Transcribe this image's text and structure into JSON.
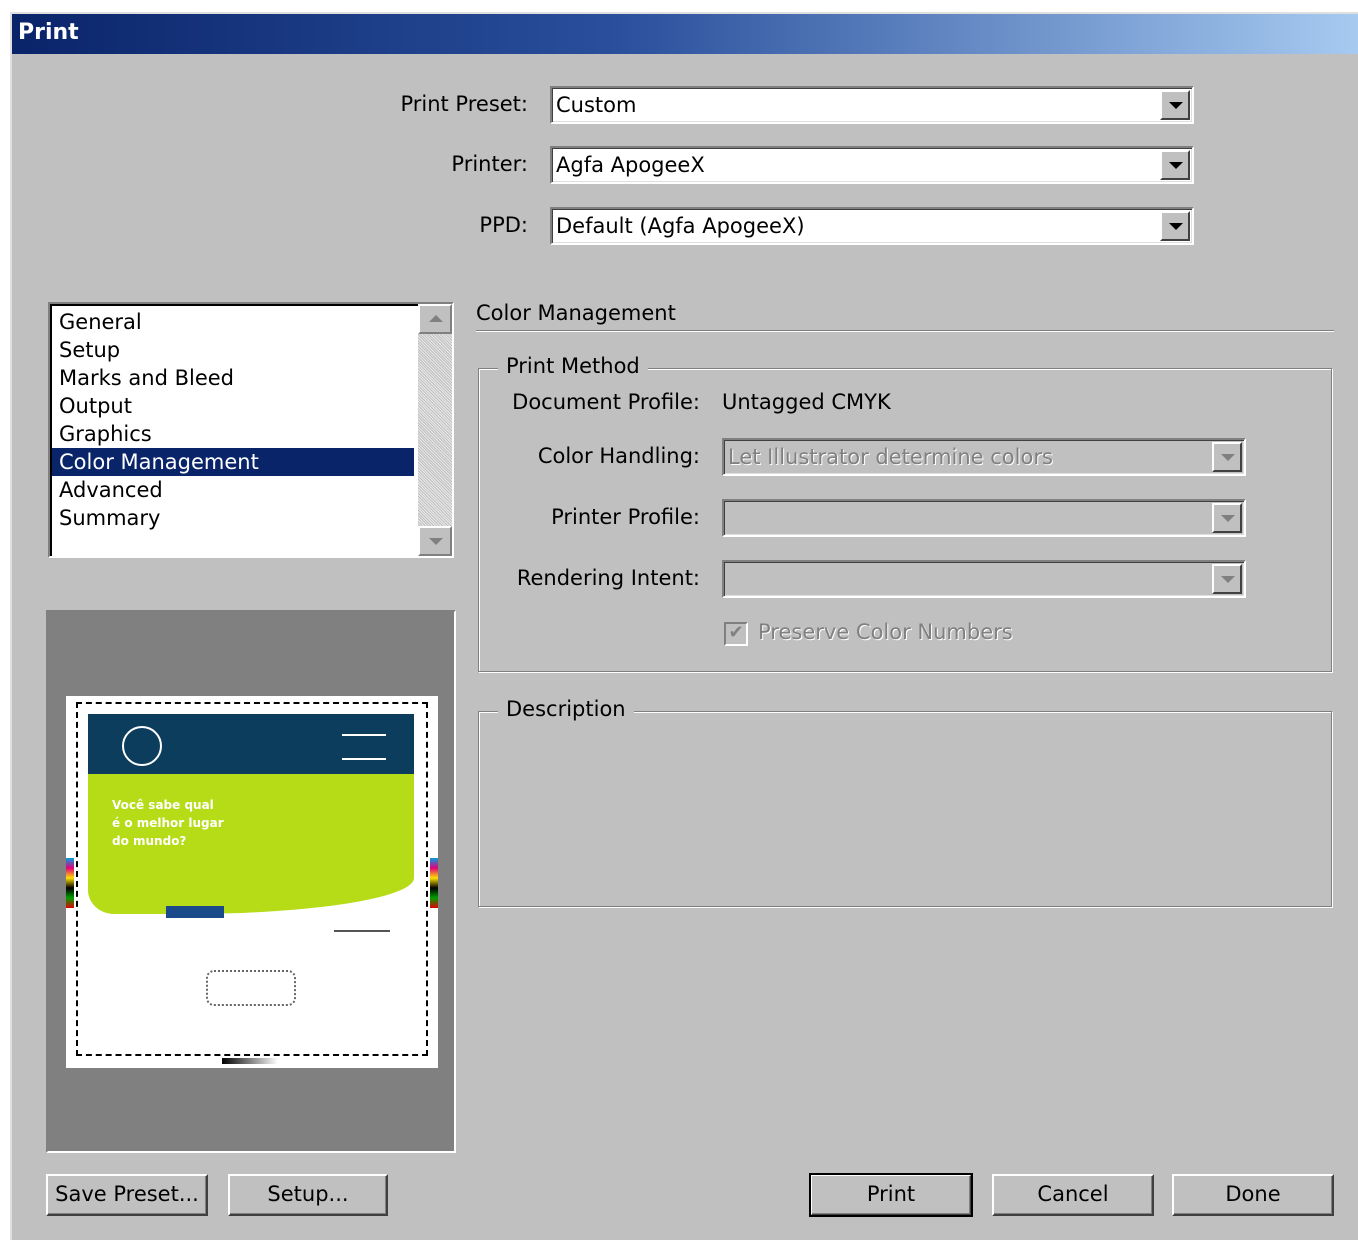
{
  "window": {
    "title": "Print"
  },
  "top_fields": {
    "preset": {
      "label": "Print Preset:",
      "value": "Custom"
    },
    "printer": {
      "label": "Printer:",
      "value": "Agfa ApogeeX"
    },
    "ppd": {
      "label": "PPD:",
      "value": "Default (Agfa ApogeeX)"
    }
  },
  "sidebar": {
    "items": [
      {
        "label": "General"
      },
      {
        "label": "Setup"
      },
      {
        "label": "Marks and Bleed"
      },
      {
        "label": "Output"
      },
      {
        "label": "Graphics"
      },
      {
        "label": "Color Management",
        "selected": true
      },
      {
        "label": "Advanced"
      },
      {
        "label": "Summary"
      }
    ]
  },
  "preview": {
    "headline_lines": [
      "Você sabe qual",
      "é o melhor lugar",
      "do mundo?"
    ],
    "colors": {
      "header": "#0d3d5c",
      "band": "#b5dc17",
      "paper": "#ffffff"
    }
  },
  "panel": {
    "title": "Color Management",
    "print_method": {
      "title": "Print Method",
      "document_profile_label": "Document Profile:",
      "document_profile_value": "Untagged CMYK",
      "color_handling_label": "Color Handling:",
      "color_handling_value": "Let Illustrator determine colors",
      "printer_profile_label": "Printer Profile:",
      "printer_profile_value": "",
      "rendering_intent_label": "Rendering Intent:",
      "rendering_intent_value": "",
      "preserve_label": "Preserve Color Numbers",
      "preserve_checked": true
    },
    "description": {
      "title": "Description",
      "text": ""
    }
  },
  "buttons": {
    "save_preset": "Save Preset...",
    "setup": "Setup...",
    "print": "Print",
    "cancel": "Cancel",
    "done": "Done"
  }
}
